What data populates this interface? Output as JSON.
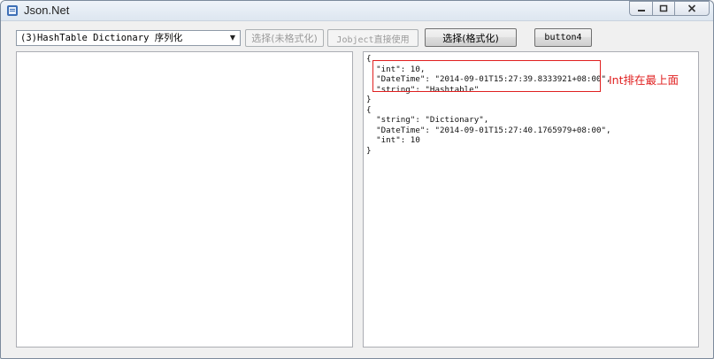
{
  "window": {
    "title": "Json.Net",
    "controls": {
      "minimize": "minimize",
      "maximize": "maximize",
      "close": "close"
    }
  },
  "toolbar": {
    "mode_select": {
      "value": "(3)HashTable Dictionary 序列化"
    },
    "btn_select_unformatted": "选择(未格式化)",
    "btn_jobject": "Jobject直接使用",
    "btn_select_formatted": "选择(格式化)",
    "btn_button4": "button4"
  },
  "left_textbox": {
    "text": ""
  },
  "right_textbox": {
    "text": "{\n  \"int\": 10,\n  \"DateTime\": \"2014-09-01T15:27:39.8333921+08:00\",\n  \"string\": \"Hashtable\"\n}\n{\n  \"string\": \"Dictionary\",\n  \"DateTime\": \"2014-09-01T15:27:40.1765979+08:00\",\n  \"int\": 10\n}"
  },
  "annotation": {
    "text": "Int排在最上面",
    "color": "#e02020"
  },
  "colors": {
    "highlight": "#e02020",
    "window_bg": "#f0f0f0"
  }
}
